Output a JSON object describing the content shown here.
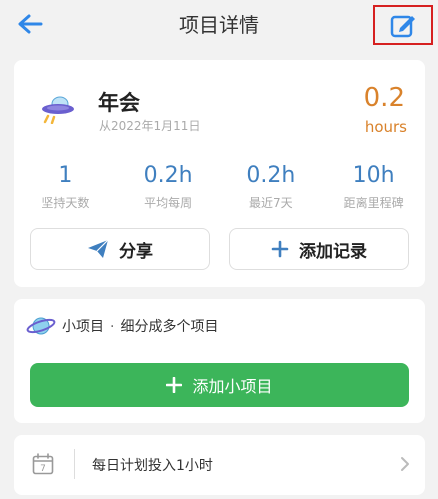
{
  "header": {
    "title": "项目详情",
    "back_icon": "arrow-left-icon",
    "edit_icon": "edit-icon",
    "accent": "#2f87e8"
  },
  "project": {
    "name": "年会",
    "since": "从2022年1月11日",
    "hours_value": "0.2",
    "hours_unit": "hours",
    "icon": "ufo-icon"
  },
  "stats": [
    {
      "value": "1",
      "label": "坚持天数"
    },
    {
      "value": "0.2h",
      "label": "平均每周"
    },
    {
      "value": "0.2h",
      "label": "最近7天"
    },
    {
      "value": "10h",
      "label": "距离里程碑"
    }
  ],
  "actions": {
    "share_label": "分享",
    "add_record_label": "添加记录"
  },
  "subprojects": {
    "title": "小项目",
    "subtitle": "细分成多个项目",
    "add_label": "添加小项目",
    "icon": "planet-icon"
  },
  "plan": {
    "text": "每日计划投入1小时",
    "calendar_day": "7"
  },
  "colors": {
    "orange": "#d9822b",
    "blue": "#3f7fbf",
    "green": "#3cb55a",
    "highlight": "#d62020"
  }
}
